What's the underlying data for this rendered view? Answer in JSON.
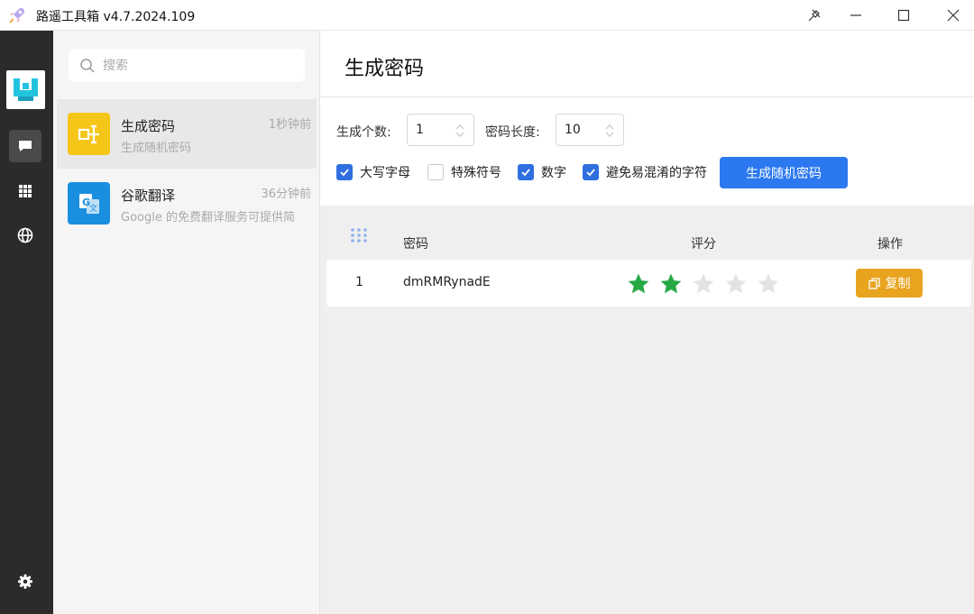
{
  "window": {
    "title": "路遥工具箱 v4.7.2024.109"
  },
  "search": {
    "placeholder": "搜索"
  },
  "list": {
    "items": [
      {
        "title": "生成密码",
        "subtitle": "生成随机密码",
        "time": "1秒钟前",
        "icon": "password-tool-icon",
        "color": "#f5c518"
      },
      {
        "title": "谷歌翻译",
        "subtitle": "Google 的免费翻译服务可提供简",
        "time": "36分钟前",
        "icon": "google-translate-icon",
        "color": "#1a8fe0"
      }
    ]
  },
  "main": {
    "title": "生成密码",
    "count_label": "生成个数:",
    "count_value": "1",
    "length_label": "密码长度:",
    "length_value": "10",
    "options": [
      {
        "label": "大写字母",
        "checked": true
      },
      {
        "label": "特殊符号",
        "checked": false
      },
      {
        "label": "数字",
        "checked": true
      },
      {
        "label": "避免易混淆的字符",
        "checked": true
      }
    ],
    "generate_label": "生成随机密码"
  },
  "table": {
    "headers": {
      "password": "密码",
      "score": "评分",
      "action": "操作"
    },
    "rows": [
      {
        "index": "1",
        "password": "dmRMRynadE",
        "score": 2,
        "max_score": 5,
        "copy_label": "复制"
      }
    ]
  },
  "colors": {
    "accent": "#2b78f0",
    "copy": "#e8a41f",
    "star_on": "#27a844",
    "star_off": "#e3e3e3",
    "rail": "#2b2b2b"
  }
}
